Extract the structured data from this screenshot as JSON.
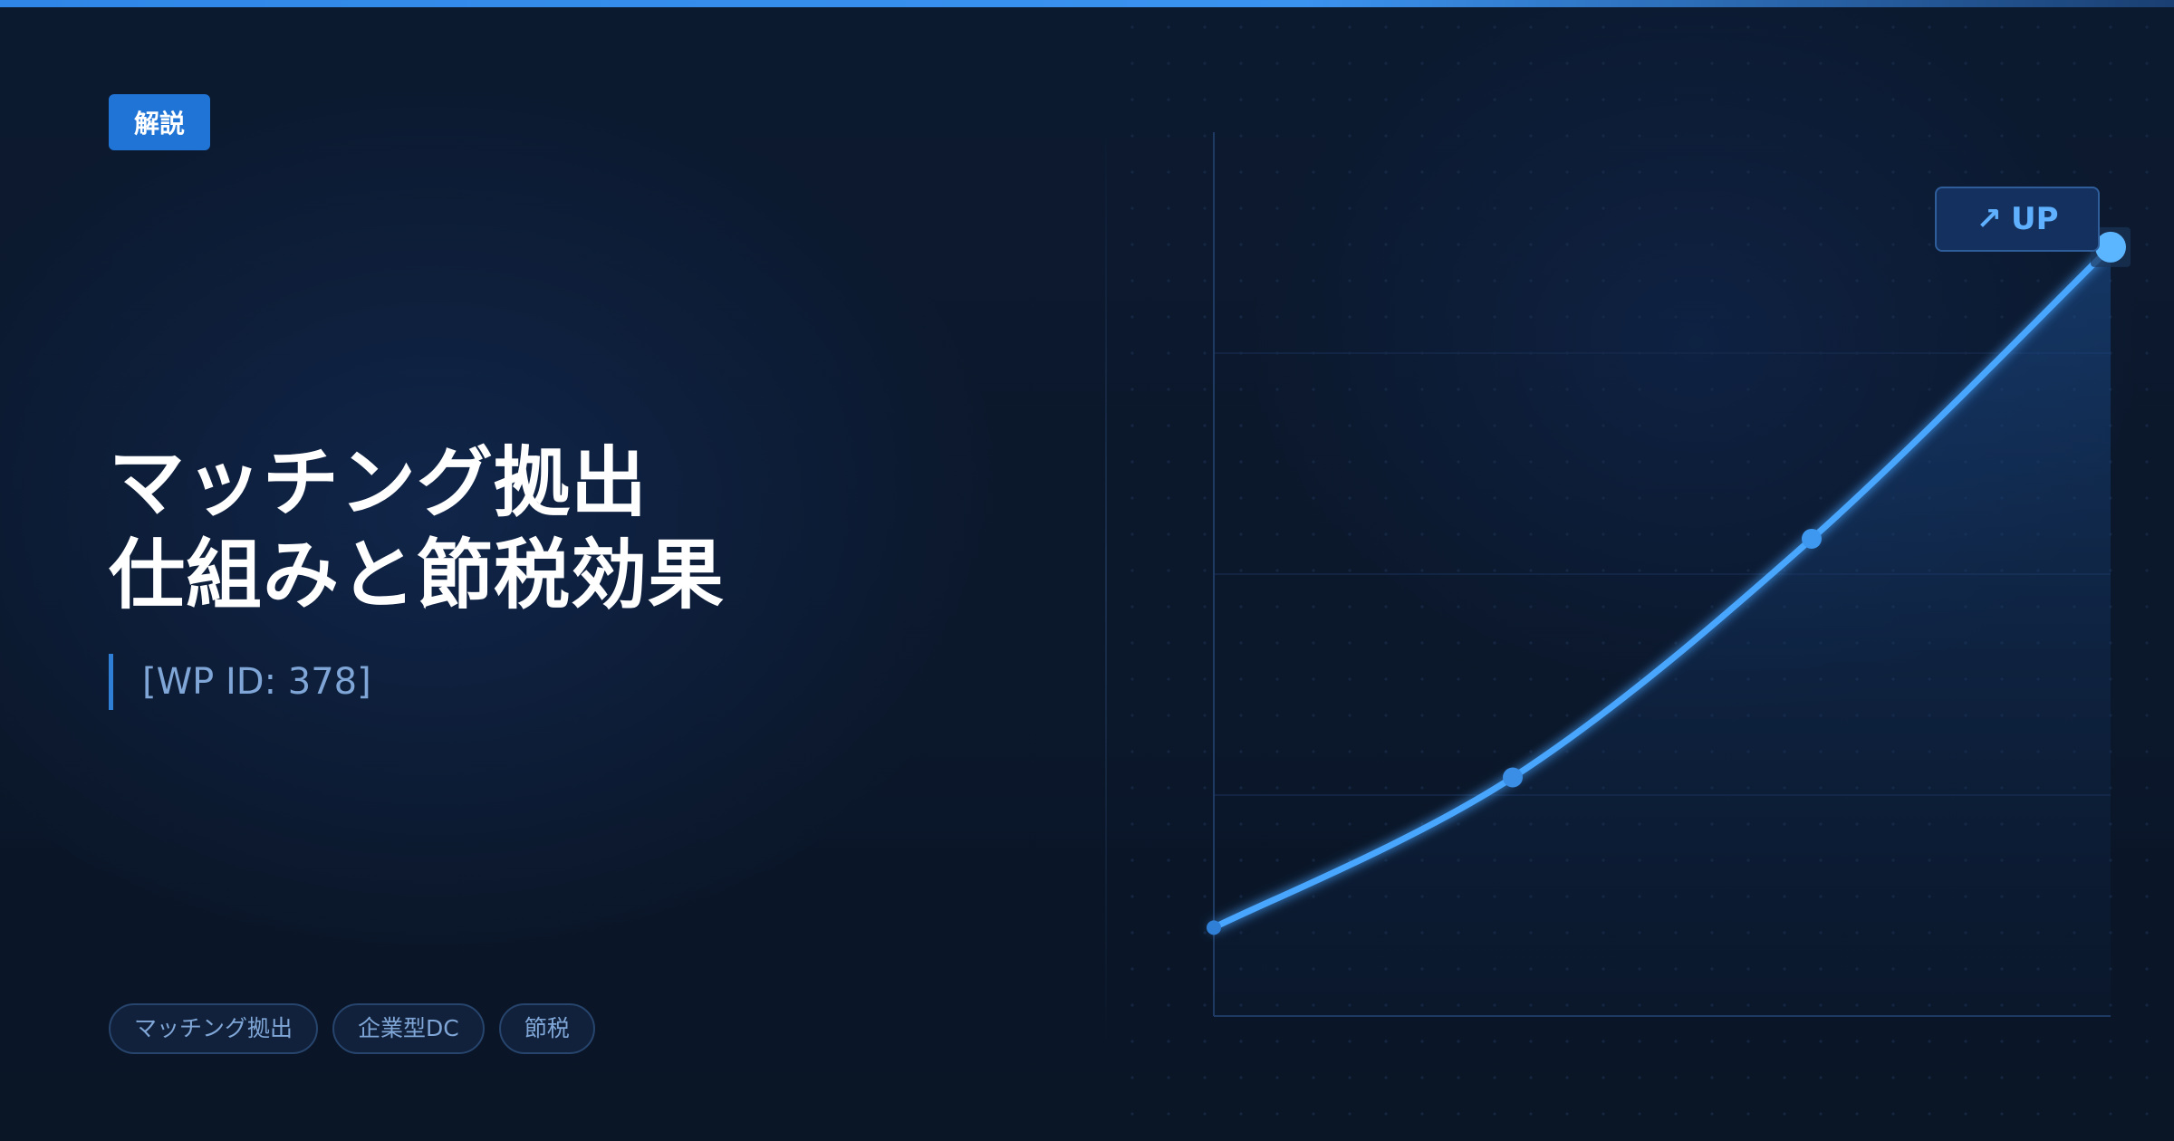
{
  "header": {
    "category_badge": "解説"
  },
  "article": {
    "title_lines": [
      "マッチング拠出",
      "仕組みと節税効果"
    ],
    "subtitle": "[WP ID: 378]",
    "tags": [
      "マッチング拠出",
      "企業型DC",
      "節税"
    ]
  },
  "chart_badge": {
    "arrow_icon": "↗",
    "label": "UP"
  },
  "colors": {
    "accent": "#1f74d6",
    "curve": "#4aa6ff",
    "background": "#0b1628"
  },
  "chart_data": {
    "type": "line",
    "title": "",
    "xlabel": "",
    "ylabel": "",
    "x": [
      0,
      1,
      2,
      3
    ],
    "series": [
      {
        "values": [
          10,
          27,
          54,
          87
        ]
      }
    ],
    "xlim": [
      0,
      3
    ],
    "ylim": [
      0,
      100
    ],
    "grid": true
  }
}
